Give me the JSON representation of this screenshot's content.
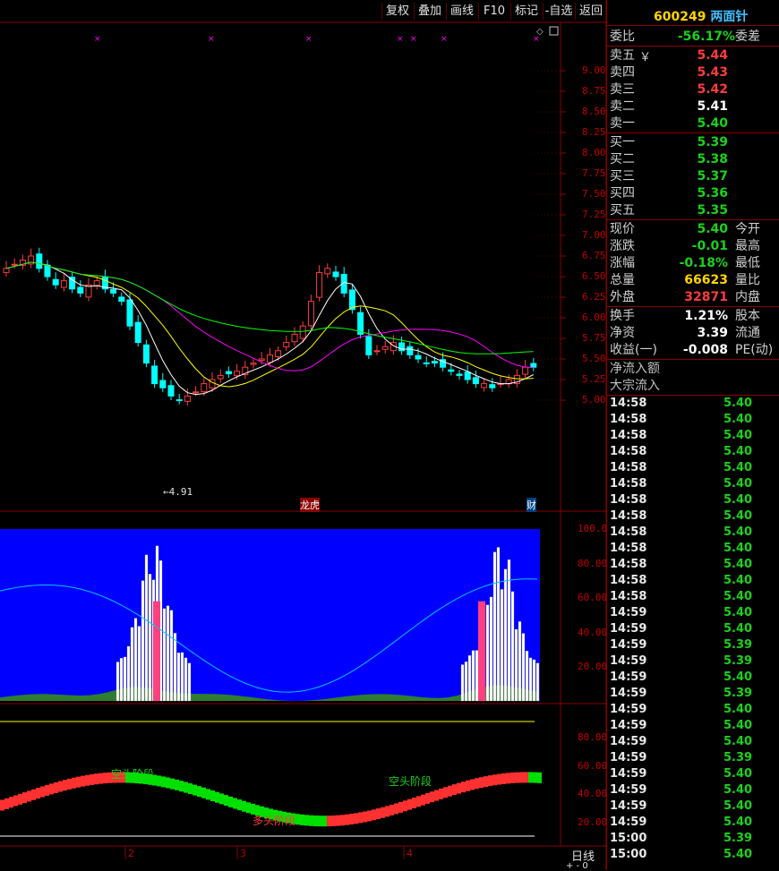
{
  "toolbar": {
    "buttons": [
      "复权",
      "叠加",
      "画线",
      "F10",
      "标记",
      "-自选",
      "返回"
    ]
  },
  "stock": {
    "code": "600249",
    "name": "两面针"
  },
  "quote": {
    "weibi_label": "委比",
    "weibi_value": "-56.17%",
    "weicha_label": "委差",
    "sell": [
      {
        "label": "卖五",
        "extra": "￥",
        "price": "5.44"
      },
      {
        "label": "卖四",
        "price": "5.43"
      },
      {
        "label": "卖三",
        "price": "5.42"
      },
      {
        "label": "卖二",
        "price": "5.41"
      },
      {
        "label": "卖一",
        "price": "5.40"
      }
    ],
    "buy": [
      {
        "label": "买一",
        "price": "5.39"
      },
      {
        "label": "买二",
        "price": "5.38"
      },
      {
        "label": "买三",
        "price": "5.37"
      },
      {
        "label": "买四",
        "price": "5.36"
      },
      {
        "label": "买五",
        "price": "5.35"
      }
    ],
    "stats": [
      {
        "label": "现价",
        "value": "5.40",
        "tag": "今开"
      },
      {
        "label": "涨跌",
        "value": "-0.01",
        "tag": "最高"
      },
      {
        "label": "涨幅",
        "value": "-0.18%",
        "tag": "最低"
      },
      {
        "label": "总量",
        "value": "66623",
        "tag": "量比"
      },
      {
        "label": "外盘",
        "value": "32871",
        "tag": "内盘"
      }
    ],
    "stats2": [
      {
        "label": "换手",
        "value": "1.21%",
        "tag": "股本"
      },
      {
        "label": "净资",
        "value": "3.39",
        "tag": "流通"
      },
      {
        "label": "收益(一)",
        "value": "-0.008",
        "tag": "PE(动)"
      }
    ],
    "flow": [
      "净流入额",
      "大宗流入"
    ]
  },
  "ticks": [
    [
      "14:58",
      "5.40"
    ],
    [
      "14:58",
      "5.40"
    ],
    [
      "14:58",
      "5.40"
    ],
    [
      "14:58",
      "5.40"
    ],
    [
      "14:58",
      "5.40"
    ],
    [
      "14:58",
      "5.40"
    ],
    [
      "14:58",
      "5.40"
    ],
    [
      "14:58",
      "5.40"
    ],
    [
      "14:58",
      "5.40"
    ],
    [
      "14:58",
      "5.40"
    ],
    [
      "14:58",
      "5.40"
    ],
    [
      "14:58",
      "5.40"
    ],
    [
      "14:58",
      "5.40"
    ],
    [
      "14:59",
      "5.40"
    ],
    [
      "14:59",
      "5.40"
    ],
    [
      "14:59",
      "5.39"
    ],
    [
      "14:59",
      "5.39"
    ],
    [
      "14:59",
      "5.40"
    ],
    [
      "14:59",
      "5.39"
    ],
    [
      "14:59",
      "5.40"
    ],
    [
      "14:59",
      "5.40"
    ],
    [
      "14:59",
      "5.40"
    ],
    [
      "14:59",
      "5.39"
    ],
    [
      "14:59",
      "5.40"
    ],
    [
      "14:59",
      "5.40"
    ],
    [
      "14:59",
      "5.40"
    ],
    [
      "14:59",
      "5.40"
    ],
    [
      "15:00",
      "5.39"
    ],
    [
      "15:00",
      "5.40"
    ]
  ],
  "chart": {
    "price_axis": [
      "9.00",
      "8.75",
      "8.50",
      "8.25",
      "8.00",
      "7.75",
      "7.50",
      "7.25",
      "7.00",
      "6.75",
      "6.50",
      "6.25",
      "6.00",
      "5.75",
      "5.50",
      "5.25",
      "5.00"
    ],
    "low_label": "4.91",
    "event_labels": [
      "龙虎",
      "财"
    ],
    "ind1_axis": [
      "100.0",
      "80.00",
      "60.00",
      "40.00",
      "20.00"
    ],
    "ind2_axis": [
      "80.00",
      "60.00",
      "40.00",
      "20.00"
    ],
    "phase_labels": [
      "空头阶段",
      "多头阶段",
      "空头阶段"
    ],
    "x_labels": [
      "2",
      "3",
      "4"
    ],
    "period": "日线",
    "zoom": "+ - 0"
  },
  "colors": {
    "up": "#ff3c3c",
    "down": "#00ffff",
    "ma5": "#ffffff",
    "ma10": "#ffff00",
    "ma20": "#ff00ff",
    "ma60": "#00ff00"
  }
}
